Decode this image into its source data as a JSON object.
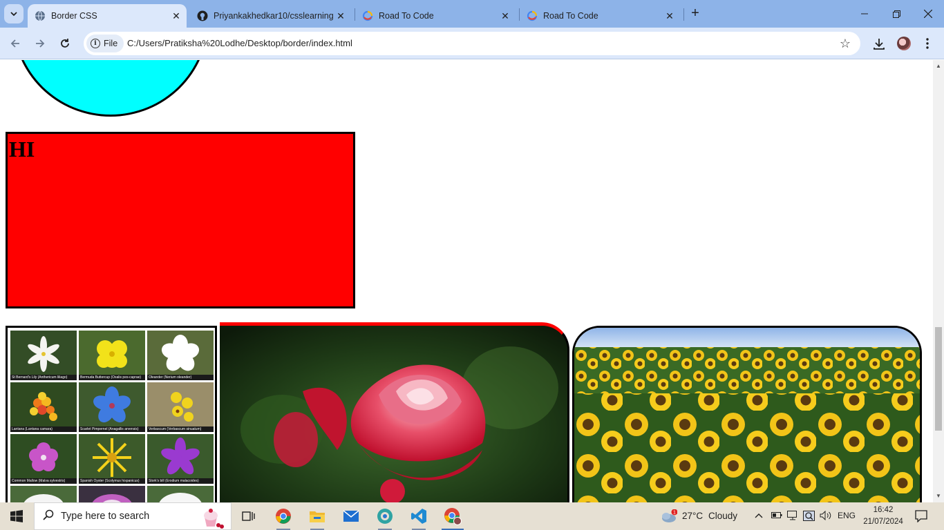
{
  "browser": {
    "tabs": [
      {
        "title": "Border CSS",
        "favicon": "globe-icon",
        "active": true
      },
      {
        "title": "Priyankakhedkar10/csslearning",
        "favicon": "github-icon",
        "active": false
      },
      {
        "title": "Road To Code",
        "favicon": "google-cloud-icon",
        "active": false
      },
      {
        "title": "Road To Code",
        "favicon": "google-cloud-icon",
        "active": false
      }
    ],
    "address": {
      "chip_label": "File",
      "url": "C:/Users/Pratiksha%20Lodhe/Desktop/border/index.html"
    }
  },
  "page": {
    "heading": "HI",
    "colors": {
      "circle": "#00ffff",
      "box": "#ff0000",
      "border": "#000000",
      "rose_top_border": "#ff0000"
    },
    "flower_grid": {
      "captions": [
        "St Bernard's Lily (Anthericum liliago)",
        "Bermuda Buttercup (Oxalis pes-caprae)",
        "Oleander (Nerium oleander)",
        "Lantana (Lantana camara)",
        "Scarlet Pimpernel (Anagallis arvensis)",
        "Verbascum (Verbascum sinuatum)",
        "Common Mallow (Malva sylvestris)",
        "Spanish Oyster (Scolymus hispanicus)",
        "Stork's bill (Erodium malacoides)"
      ]
    }
  },
  "taskbar": {
    "search_placeholder": "Type here to search",
    "weather": {
      "temp": "27°C",
      "condition": "Cloudy",
      "badge": "1"
    },
    "language": "ENG",
    "time": "16:42",
    "date": "21/07/2024"
  }
}
